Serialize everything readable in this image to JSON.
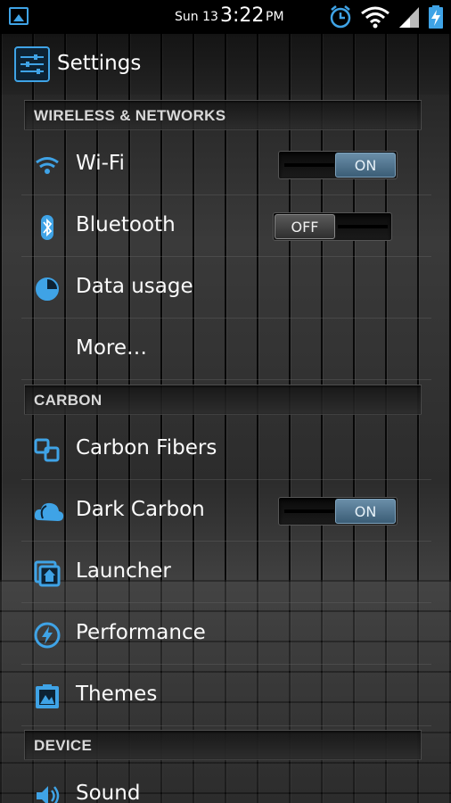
{
  "status_bar": {
    "date": "Sun 13",
    "time": "3:22",
    "ampm": "PM",
    "icons": [
      "picture-icon",
      "alarm-icon",
      "wifi-icon",
      "signal-icon",
      "battery-charging-icon"
    ]
  },
  "action_bar": {
    "title": "Settings",
    "icon": "settings-sliders-icon"
  },
  "sections": {
    "wireless": {
      "header": "WIRELESS & NETWORKS"
    },
    "carbon": {
      "header": "CARBON"
    },
    "device": {
      "header": "DEVICE"
    }
  },
  "items": {
    "wifi": {
      "label": "Wi-Fi",
      "toggle": "ON",
      "icon": "wifi-icon"
    },
    "bluetooth": {
      "label": "Bluetooth",
      "toggle": "OFF",
      "icon": "bluetooth-icon"
    },
    "data_usage": {
      "label": "Data usage",
      "icon": "pie-chart-icon"
    },
    "more": {
      "label": "More…"
    },
    "carbon_fibers": {
      "label": "Carbon Fibers",
      "icon": "carbon-fibers-icon"
    },
    "dark_carbon": {
      "label": "Dark Carbon",
      "toggle": "ON",
      "icon": "cloud-icon"
    },
    "launcher": {
      "label": "Launcher",
      "icon": "home-icon"
    },
    "performance": {
      "label": "Performance",
      "icon": "lightning-icon"
    },
    "themes": {
      "label": "Themes",
      "icon": "themes-icon"
    },
    "sound": {
      "label": "Sound",
      "icon": "speaker-icon"
    }
  },
  "colors": {
    "accent": "#3fa3e6",
    "toggle_on": "#4f7590",
    "toggle_off": "#454545"
  }
}
